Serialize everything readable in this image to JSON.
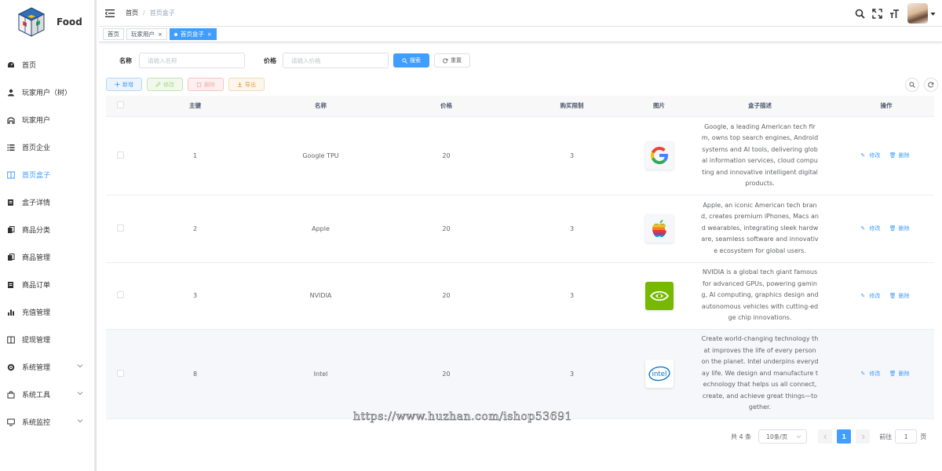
{
  "app": {
    "title": "Food"
  },
  "sidebar": {
    "items": [
      {
        "label": "首页",
        "icon": "dashboard-icon"
      },
      {
        "label": "玩家用户（树）",
        "icon": "user-icon"
      },
      {
        "label": "玩家用户",
        "icon": "people-icon"
      },
      {
        "label": "首页企业",
        "icon": "list-icon"
      },
      {
        "label": "首页盒子",
        "icon": "book-icon",
        "active": true
      },
      {
        "label": "盒子详情",
        "icon": "form-icon"
      },
      {
        "label": "商品分类",
        "icon": "copy-icon"
      },
      {
        "label": "商品管理",
        "icon": "copy-icon"
      },
      {
        "label": "商品订单",
        "icon": "form-icon"
      },
      {
        "label": "充值管理",
        "icon": "chart-icon"
      },
      {
        "label": "提现管理",
        "icon": "book-icon"
      },
      {
        "label": "系统管理",
        "icon": "gear-icon",
        "submenu": true
      },
      {
        "label": "系统工具",
        "icon": "tool-icon",
        "submenu": true
      },
      {
        "label": "系统监控",
        "icon": "monitor-icon",
        "submenu": true
      }
    ]
  },
  "header": {
    "breadcrumb": [
      "首页",
      "首页盒子"
    ]
  },
  "tags": [
    {
      "label": "首页",
      "active": false,
      "closable": false
    },
    {
      "label": "玩家用户",
      "active": false,
      "closable": true
    },
    {
      "label": "首页盒子",
      "active": true,
      "closable": true
    }
  ],
  "search": {
    "name_label": "名称",
    "name_placeholder": "请输入名称",
    "price_label": "价格",
    "price_placeholder": "请输入价格",
    "search_button": "搜索",
    "reset_button": "重置"
  },
  "toolbar": {
    "add": "新增",
    "edit": "修改",
    "delete": "删除",
    "export": "导出"
  },
  "table": {
    "columns": [
      "主键",
      "名称",
      "价格",
      "购买限制",
      "图片",
      "盒子描述",
      "操作"
    ],
    "rows": [
      {
        "id": "1",
        "name": "Google TPU",
        "price": "20",
        "limit": "3",
        "logo": "google-logo",
        "desc": "Google, a leading American tech firm, owns top search engines, Android systems and AI tools, delivering global information services, cloud computing and innovative intelligent digital products.",
        "edit": "修改",
        "delete": "删除"
      },
      {
        "id": "2",
        "name": "Apple",
        "price": "20",
        "limit": "3",
        "logo": "apple-logo",
        "desc": "Apple, an iconic American tech brand, creates premium iPhones, Macs and wearables, integrating sleek hardware, seamless software and innovative ecosystem for global users.",
        "edit": "修改",
        "delete": "删除"
      },
      {
        "id": "3",
        "name": "NVIDIA",
        "price": "20",
        "limit": "3",
        "logo": "nvidia-logo",
        "desc": "NVIDIA is a global tech giant famous for advanced GPUs, powering gaming, AI computing, graphics design and autonomous vehicles with cutting-edge chip innovations.",
        "edit": "修改",
        "delete": "删除"
      },
      {
        "id": "8",
        "name": "Intel",
        "price": "20",
        "limit": "3",
        "logo": "intel-logo",
        "desc": "Create world-changing technology that improves the life of every person on the planet. Intel underpins everyday life. We design and manufacture technology that helps us all connect, create, and achieve great things—together.",
        "edit": "修改",
        "delete": "删除"
      }
    ]
  },
  "pagination": {
    "total": "共 4 条",
    "page_size": "10条/页",
    "current_page": "1",
    "goto_prefix": "前往",
    "goto_value": "1",
    "goto_suffix": "页"
  },
  "watermark": "https://www.huzhan.com/ishop53691",
  "colors": {
    "primary": "#409eff",
    "logo_intel": "#0071c5",
    "logo_nvidia": "#76b900"
  }
}
